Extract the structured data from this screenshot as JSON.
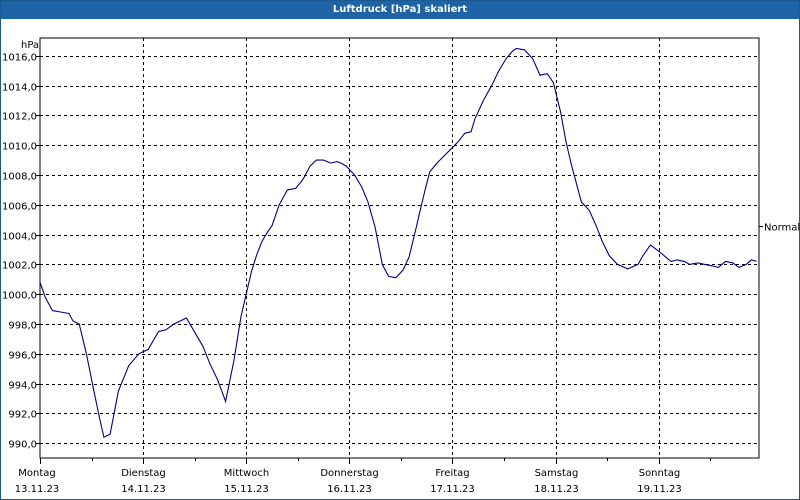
{
  "chart_data": {
    "type": "line",
    "title": "Luftdruck [hPa] skaliert",
    "ylabel": "hPa",
    "ylim": [
      989.0,
      1017.2
    ],
    "yticks": [
      "990,0",
      "992,0",
      "994,0",
      "996,0",
      "998,0",
      "1000,0",
      "1002,0",
      "1004,0",
      "1006,0",
      "1008,0",
      "1010,0",
      "1012,0",
      "1014,0",
      "1016,0"
    ],
    "xlim": [
      0,
      7.0
    ],
    "day_labels": [
      {
        "day": "Montag",
        "date": "13.11.23"
      },
      {
        "day": "Dienstag",
        "date": "14.11.23"
      },
      {
        "day": "Mittwoch",
        "date": "15.11.23"
      },
      {
        "day": "Donnerstag",
        "date": "16.11.23"
      },
      {
        "day": "Freitag",
        "date": "17.11.23"
      },
      {
        "day": "Samstag",
        "date": "18.11.23"
      },
      {
        "day": "Sonntag",
        "date": "19.11.23"
      }
    ],
    "reference": {
      "label": "Normal",
      "value": 1004.6
    },
    "grid": true,
    "line_color": "#00008b",
    "series": [
      {
        "x": [
          0.0,
          0.05,
          0.12,
          0.2,
          0.28,
          0.32,
          0.38,
          0.45,
          0.52,
          0.58,
          0.62,
          0.68,
          0.76,
          0.86,
          0.96,
          1.05,
          1.15,
          1.22,
          1.3,
          1.42,
          1.58,
          1.65,
          1.72,
          1.8,
          1.88,
          1.95,
          2.05,
          2.1,
          2.15,
          2.2,
          2.25,
          2.32,
          2.4,
          2.48,
          2.55,
          2.62,
          2.68,
          2.75,
          2.82,
          2.88,
          2.92,
          2.97,
          3.05,
          3.12,
          3.18,
          3.25,
          3.32,
          3.38,
          3.45,
          3.52,
          3.58,
          3.65,
          3.7,
          3.75,
          3.78,
          3.85,
          3.92,
          3.98,
          4.05,
          4.12,
          4.18,
          4.22,
          4.3,
          4.38,
          4.45,
          4.52,
          4.58,
          4.62,
          4.7,
          4.78,
          4.85,
          4.92,
          4.98,
          5.05,
          5.1,
          5.15,
          5.25,
          5.33,
          5.4,
          5.45,
          5.52,
          5.6,
          5.7,
          5.8,
          5.85,
          5.92,
          6.0,
          6.05,
          6.12,
          6.18,
          6.25,
          6.3,
          6.38,
          6.45,
          6.52,
          6.58,
          6.65,
          6.72,
          6.78,
          6.85,
          6.9,
          6.95
        ],
        "values": [
          1000.8,
          999.8,
          998.9,
          998.8,
          998.7,
          998.2,
          998.0,
          996.0,
          993.6,
          991.6,
          990.4,
          990.6,
          993.5,
          995.2,
          996.0,
          996.3,
          997.5,
          997.6,
          998.0,
          998.4,
          996.5,
          995.3,
          994.3,
          992.8,
          995.5,
          998.5,
          1001.5,
          1002.6,
          1003.5,
          1004.1,
          1004.6,
          1006.0,
          1007.0,
          1007.1,
          1007.7,
          1008.6,
          1009.0,
          1009.0,
          1008.8,
          1008.9,
          1008.8,
          1008.6,
          1008.0,
          1007.2,
          1006.2,
          1004.5,
          1002.0,
          1001.2,
          1001.1,
          1001.6,
          1002.5,
          1004.5,
          1006.0,
          1007.4,
          1008.2,
          1008.8,
          1009.3,
          1009.7,
          1010.2,
          1010.8,
          1010.9,
          1011.8,
          1013.0,
          1014.0,
          1015.0,
          1015.8,
          1016.3,
          1016.5,
          1016.4,
          1015.8,
          1014.7,
          1014.8,
          1014.2,
          1012.2,
          1010.3,
          1008.8,
          1006.2,
          1005.6,
          1004.5,
          1003.6,
          1002.6,
          1002.0,
          1001.7,
          1002.0,
          1002.6,
          1003.3,
          1002.9,
          1002.6,
          1002.2,
          1002.3,
          1002.2,
          1002.0,
          1002.1,
          1002.0,
          1001.9,
          1001.8,
          1002.2,
          1002.1,
          1001.8,
          1002.0,
          1002.3,
          1002.2
        ]
      }
    ]
  }
}
